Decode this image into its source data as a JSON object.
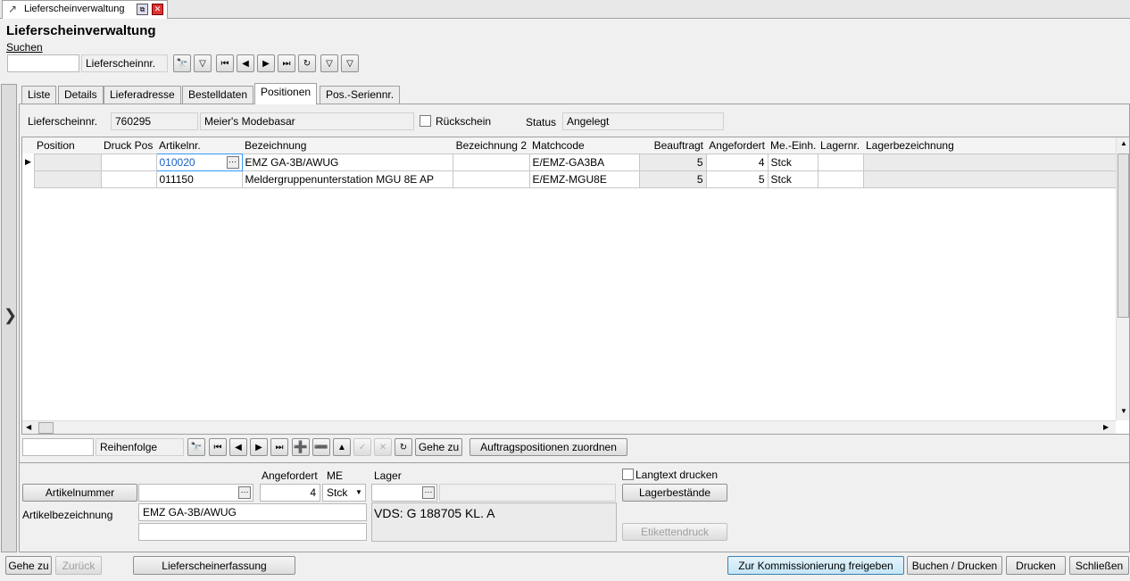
{
  "window": {
    "tab_title": "Lieferscheinverwaltung",
    "title": "Lieferscheinverwaltung"
  },
  "menu": {
    "suchen": "Suchen"
  },
  "search": {
    "value": "",
    "label": "Lieferscheinnr."
  },
  "tabs": [
    "Liste",
    "Details",
    "Lieferadresse",
    "Bestelldaten",
    "Positionen",
    "Pos.-Seriennr."
  ],
  "header": {
    "nr_label": "Lieferscheinnr.",
    "nr_value": "760295",
    "customer": "Meier's Modebasar",
    "rueckschein_label": "Rückschein",
    "status_label": "Status",
    "status_value": "Angelegt"
  },
  "grid": {
    "columns": [
      "Position",
      "Druck Pos",
      "Artikelnr.",
      "Bezeichnung",
      "Bezeichnung 2",
      "Matchcode",
      "Beauftragt",
      "Angefordert",
      "Me.-Einh.",
      "Lagernr.",
      "Lagerbezeichnung"
    ],
    "rows": [
      {
        "position": "",
        "druck": "",
        "artikelnr": "010020",
        "bez": "EMZ GA-3B/AWUG",
        "bez2": "",
        "match": "E/EMZ-GA3BA",
        "beauftragt": "5",
        "angefordert": "4",
        "me": "Stck",
        "lagernr": "",
        "lagerbez": ""
      },
      {
        "position": "",
        "druck": "",
        "artikelnr": "011150",
        "bez": "Meldergruppenunterstation MGU 8E AP",
        "bez2": "",
        "match": "E/EMZ-MGU8E",
        "beauftragt": "5",
        "angefordert": "5",
        "me": "Stck",
        "lagernr": "",
        "lagerbez": ""
      }
    ]
  },
  "nav": {
    "reihenfolge_label": "Reihenfolge",
    "gehe_zu": "Gehe zu",
    "zuordnen": "Auftragspositionen zuordnen"
  },
  "detail": {
    "artikelnummer_btn": "Artikelnummer",
    "angefordert_label": "Angefordert",
    "angefordert_value": "4",
    "me_label": "ME",
    "me_value": "Stck",
    "lager_label": "Lager",
    "langtext_label": "Langtext drucken",
    "lagerbestaende_btn": "Lagerbestände",
    "artikelbez_label": "Artikelbezeichnung",
    "artikelbez_value": "EMZ GA-3B/AWUG",
    "info_text": "VDS: G 188705 KL. A",
    "etikettendruck_btn": "Etikettendruck"
  },
  "footer": {
    "gehe_zu": "Gehe zu",
    "zurueck": "Zurück",
    "erfassung": "Lieferscheinerfassung",
    "kommission": "Zur Kommissionierung freigeben",
    "buchen_drucken": "Buchen / Drucken",
    "drucken": "Drucken",
    "schliessen": "Schließen"
  }
}
